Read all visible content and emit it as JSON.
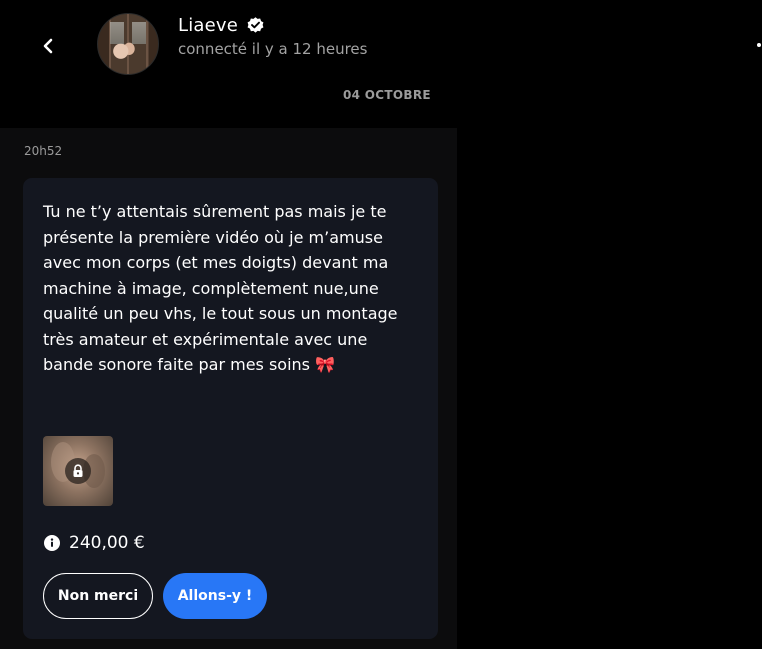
{
  "header": {
    "user_name": "Liaeve",
    "status": "connecté il y a 12 heures"
  },
  "conversation": {
    "date_divider": "04 OCTOBRE",
    "time_stamp": "20h52"
  },
  "message": {
    "text": "Tu ne t’y attentais sûrement pas mais je te présente la première vidéo où je m’amuse avec mon corps (et mes doigts) devant ma machine à image, complètement nue,une qualité un peu vhs, le tout sous un montage très amateur et expérimentale avec une bande sonore faite par mes soins 🎀",
    "price": "240,00 €",
    "decline_label": "Non merci",
    "accept_label": "Allons-y !"
  },
  "icons": {
    "back": "chevron-left-icon",
    "verified": "verified-badge-icon",
    "lock": "lock-icon",
    "info": "info-icon",
    "more": "more-icon"
  },
  "colors": {
    "background": "#000000",
    "panel": "#0c0c0d",
    "bubble": "#141720",
    "accent": "#2877f6",
    "muted_text": "#a3a3a3"
  }
}
